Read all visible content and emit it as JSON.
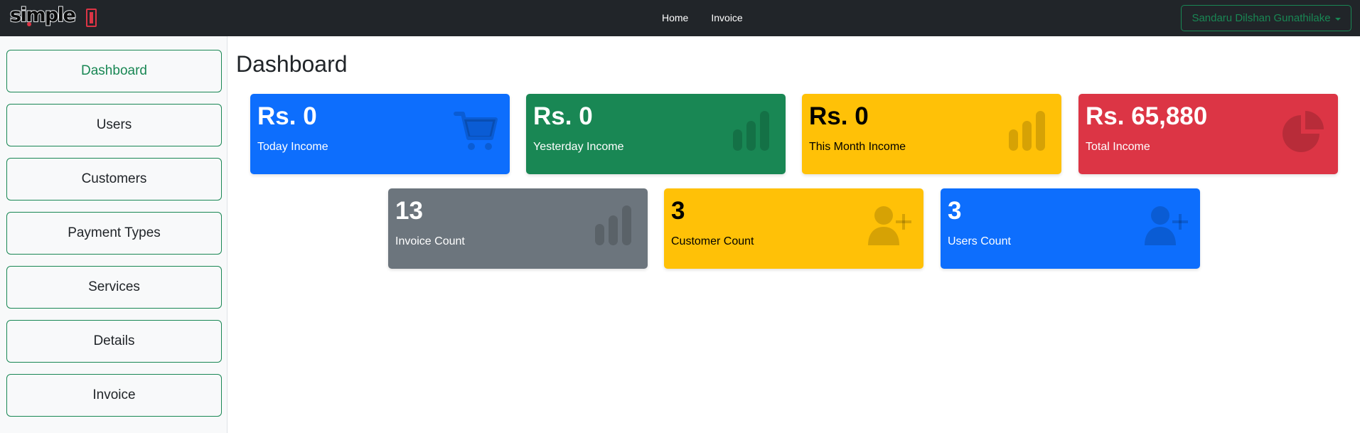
{
  "brand": {
    "name": "simple"
  },
  "nav": {
    "links": [
      "Home",
      "Invoice"
    ]
  },
  "user": {
    "name": "Sandaru Dilshan Gunathilake"
  },
  "sidebar": {
    "items": [
      "Dashboard",
      "Users",
      "Customers",
      "Payment Types",
      "Services",
      "Details",
      "Invoice"
    ],
    "active": "Dashboard"
  },
  "page": {
    "title": "Dashboard"
  },
  "cards": [
    {
      "value": "Rs. 0",
      "label": "Today Income",
      "color": "#0d6efd",
      "icon": "cart-icon"
    },
    {
      "value": "Rs. 0",
      "label": "Yesterday Income",
      "color": "#198754",
      "icon": "bar-chart-icon"
    },
    {
      "value": "Rs. 0",
      "label": "This Month Income",
      "color": "#ffc107",
      "icon": "bar-chart-icon"
    },
    {
      "value": "Rs. 65,880",
      "label": "Total Income",
      "color": "#dc3545",
      "icon": "pie-chart-icon"
    },
    {
      "value": "13",
      "label": "Invoice Count",
      "color": "#6c757d",
      "icon": "bar-chart-icon"
    },
    {
      "value": "3",
      "label": "Customer Count",
      "color": "#ffc107",
      "icon": "user-add-icon"
    },
    {
      "value": "3",
      "label": "Users Count",
      "color": "#0d6efd",
      "icon": "user-add-icon"
    }
  ]
}
